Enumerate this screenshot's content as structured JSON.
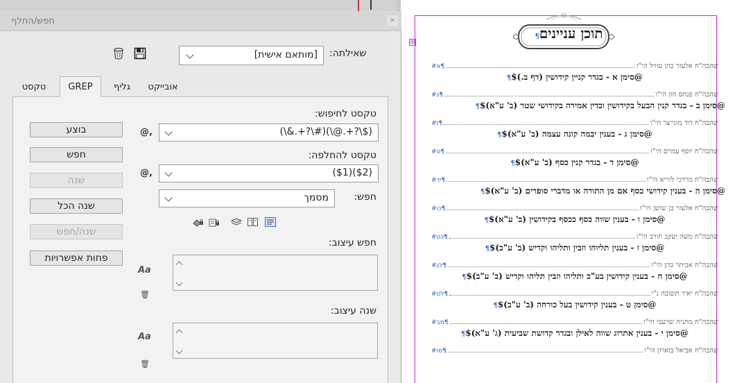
{
  "dialog": {
    "title": "חפש/החלף",
    "close_label": "×",
    "query_label": "שאילתה:",
    "query_value": "[מותאם אישית]",
    "tabs": [
      "טקסט",
      "GREP",
      "גליף",
      "אובייקט"
    ],
    "active_tab": "GREP",
    "find_label": "טקסט לחיפוש:",
    "find_value": "(\\&.+?\\#)(\\@.+?\\$)",
    "change_label": "טקסט להחלפה:",
    "change_value": "($1)($2)",
    "search_label": "חפש:",
    "search_value": "מסמך",
    "special_char_label": "@,",
    "find_format_label": "חפש עיצוב:",
    "change_format_label": "שנה עיצוב:",
    "format_icon_glyph": "Aa",
    "trash_glyph": "🗑",
    "buttons": {
      "done": "בוצע",
      "find": "חפש",
      "change": "שנה",
      "change_all": "שנה הכל",
      "change_find": "שנה/חפש",
      "fewer_options": "פחות אפשרויות"
    },
    "accent_color": "#2d66c9"
  },
  "document": {
    "toc_title": "תוכן עניינים",
    "title_pilcrow": "¶",
    "frame_marker": "⊞",
    "pilcrow_color": "#2d66c9",
    "margin_color": "#c62bd8",
    "entries": [
      {
        "type": "rabbi",
        "text": "שהבה\"ח אלעזר כהן טוויל הי\"ו",
        "page": "¶א#"
      },
      {
        "type": "siman",
        "text": "@סימן א - בגדר קניין קידושין (דף ב.)$",
        "pil": "¶"
      },
      {
        "type": "rabbi",
        "text": "שהבה\"ח פנחס חזן הי\"ו",
        "page": "¶ג#"
      },
      {
        "type": "siman",
        "text": "@סימן ב - בגדר קנין הבעל בקידושין ובדין אמירה בקידושי שטר (ב' ע\"א)$",
        "pil": "¶",
        "wide": true
      },
      {
        "type": "rabbi",
        "text": "שהבה\"ח דוד מונייצר הי\"ו",
        "page": "¶ז#"
      },
      {
        "type": "siman",
        "text": "@סימן ג - בענין יבמה קונה עצמה (ב' ע\"א)$",
        "pil": "¶"
      },
      {
        "type": "rabbi",
        "text": "שהבה\"ח יוסף עמרם הי\"ו",
        "page": "¶ט#"
      },
      {
        "type": "siman",
        "text": "@סימן ד - בגדר קנין כסף (ב' ע\"א)$",
        "pil": "¶"
      },
      {
        "type": "rabbi",
        "text": "שהבה\"ח מרדכי לוריא הי\"ו",
        "page": "¶יד#"
      },
      {
        "type": "siman",
        "text": "@סימן ה - בענין קידושי כסף אם מן התורה או מדברי סופרים (ב' ע\"א)$",
        "pil": "¶",
        "wide": true
      },
      {
        "type": "rabbi",
        "text": "שהבה\"ח אלעזר בן שושן הי\"ו",
        "page": "¶כו#"
      },
      {
        "type": "siman",
        "text": "@סימן ו - בענין שווה כסף ככסף בקידושין (ב' ע\"א)$",
        "pil": "¶"
      },
      {
        "type": "rabbi",
        "text": "שהבה\"ח משה יעקב חורב הי\"ו",
        "page": "¶כט#"
      },
      {
        "type": "siman",
        "text": "@סימן ז - בענין תליוהו וזבין ותליהו וקדיש (ב' ע\"ב)$",
        "pil": "¶"
      },
      {
        "type": "rabbi",
        "text": "שהבה\"ח אביתר כהן הי\"ו",
        "page": "¶לג#"
      },
      {
        "type": "siman",
        "text": "@סימן ח - בענין קידושין בע\"כ ותליהו וזבין תליהו וקדיש (ב' ע\"ב)$",
        "pil": "¶"
      },
      {
        "type": "rabbi",
        "text": "שהבה\"ח יאיר תשובה נ\"י",
        "page": "¶לט#"
      },
      {
        "type": "siman",
        "text": "@סימן ט - בענין קידושין בעל כורחה (ב' ע\"ב)$",
        "pil": "¶"
      },
      {
        "type": "rabbi",
        "text": "שהבה\"ח מתניה שרעבי הי\"ו",
        "page": "¶מב#"
      },
      {
        "type": "siman",
        "text": "@סימן י - בענין אתרוג שווה לאילן ובגדר קדושת שביעית (ג' ע\"א)$",
        "pil": "¶"
      },
      {
        "type": "rabbi",
        "text": "שהבה\"ח אביאל בוארון הי\"ו",
        "page": "¶מו#"
      }
    ]
  }
}
